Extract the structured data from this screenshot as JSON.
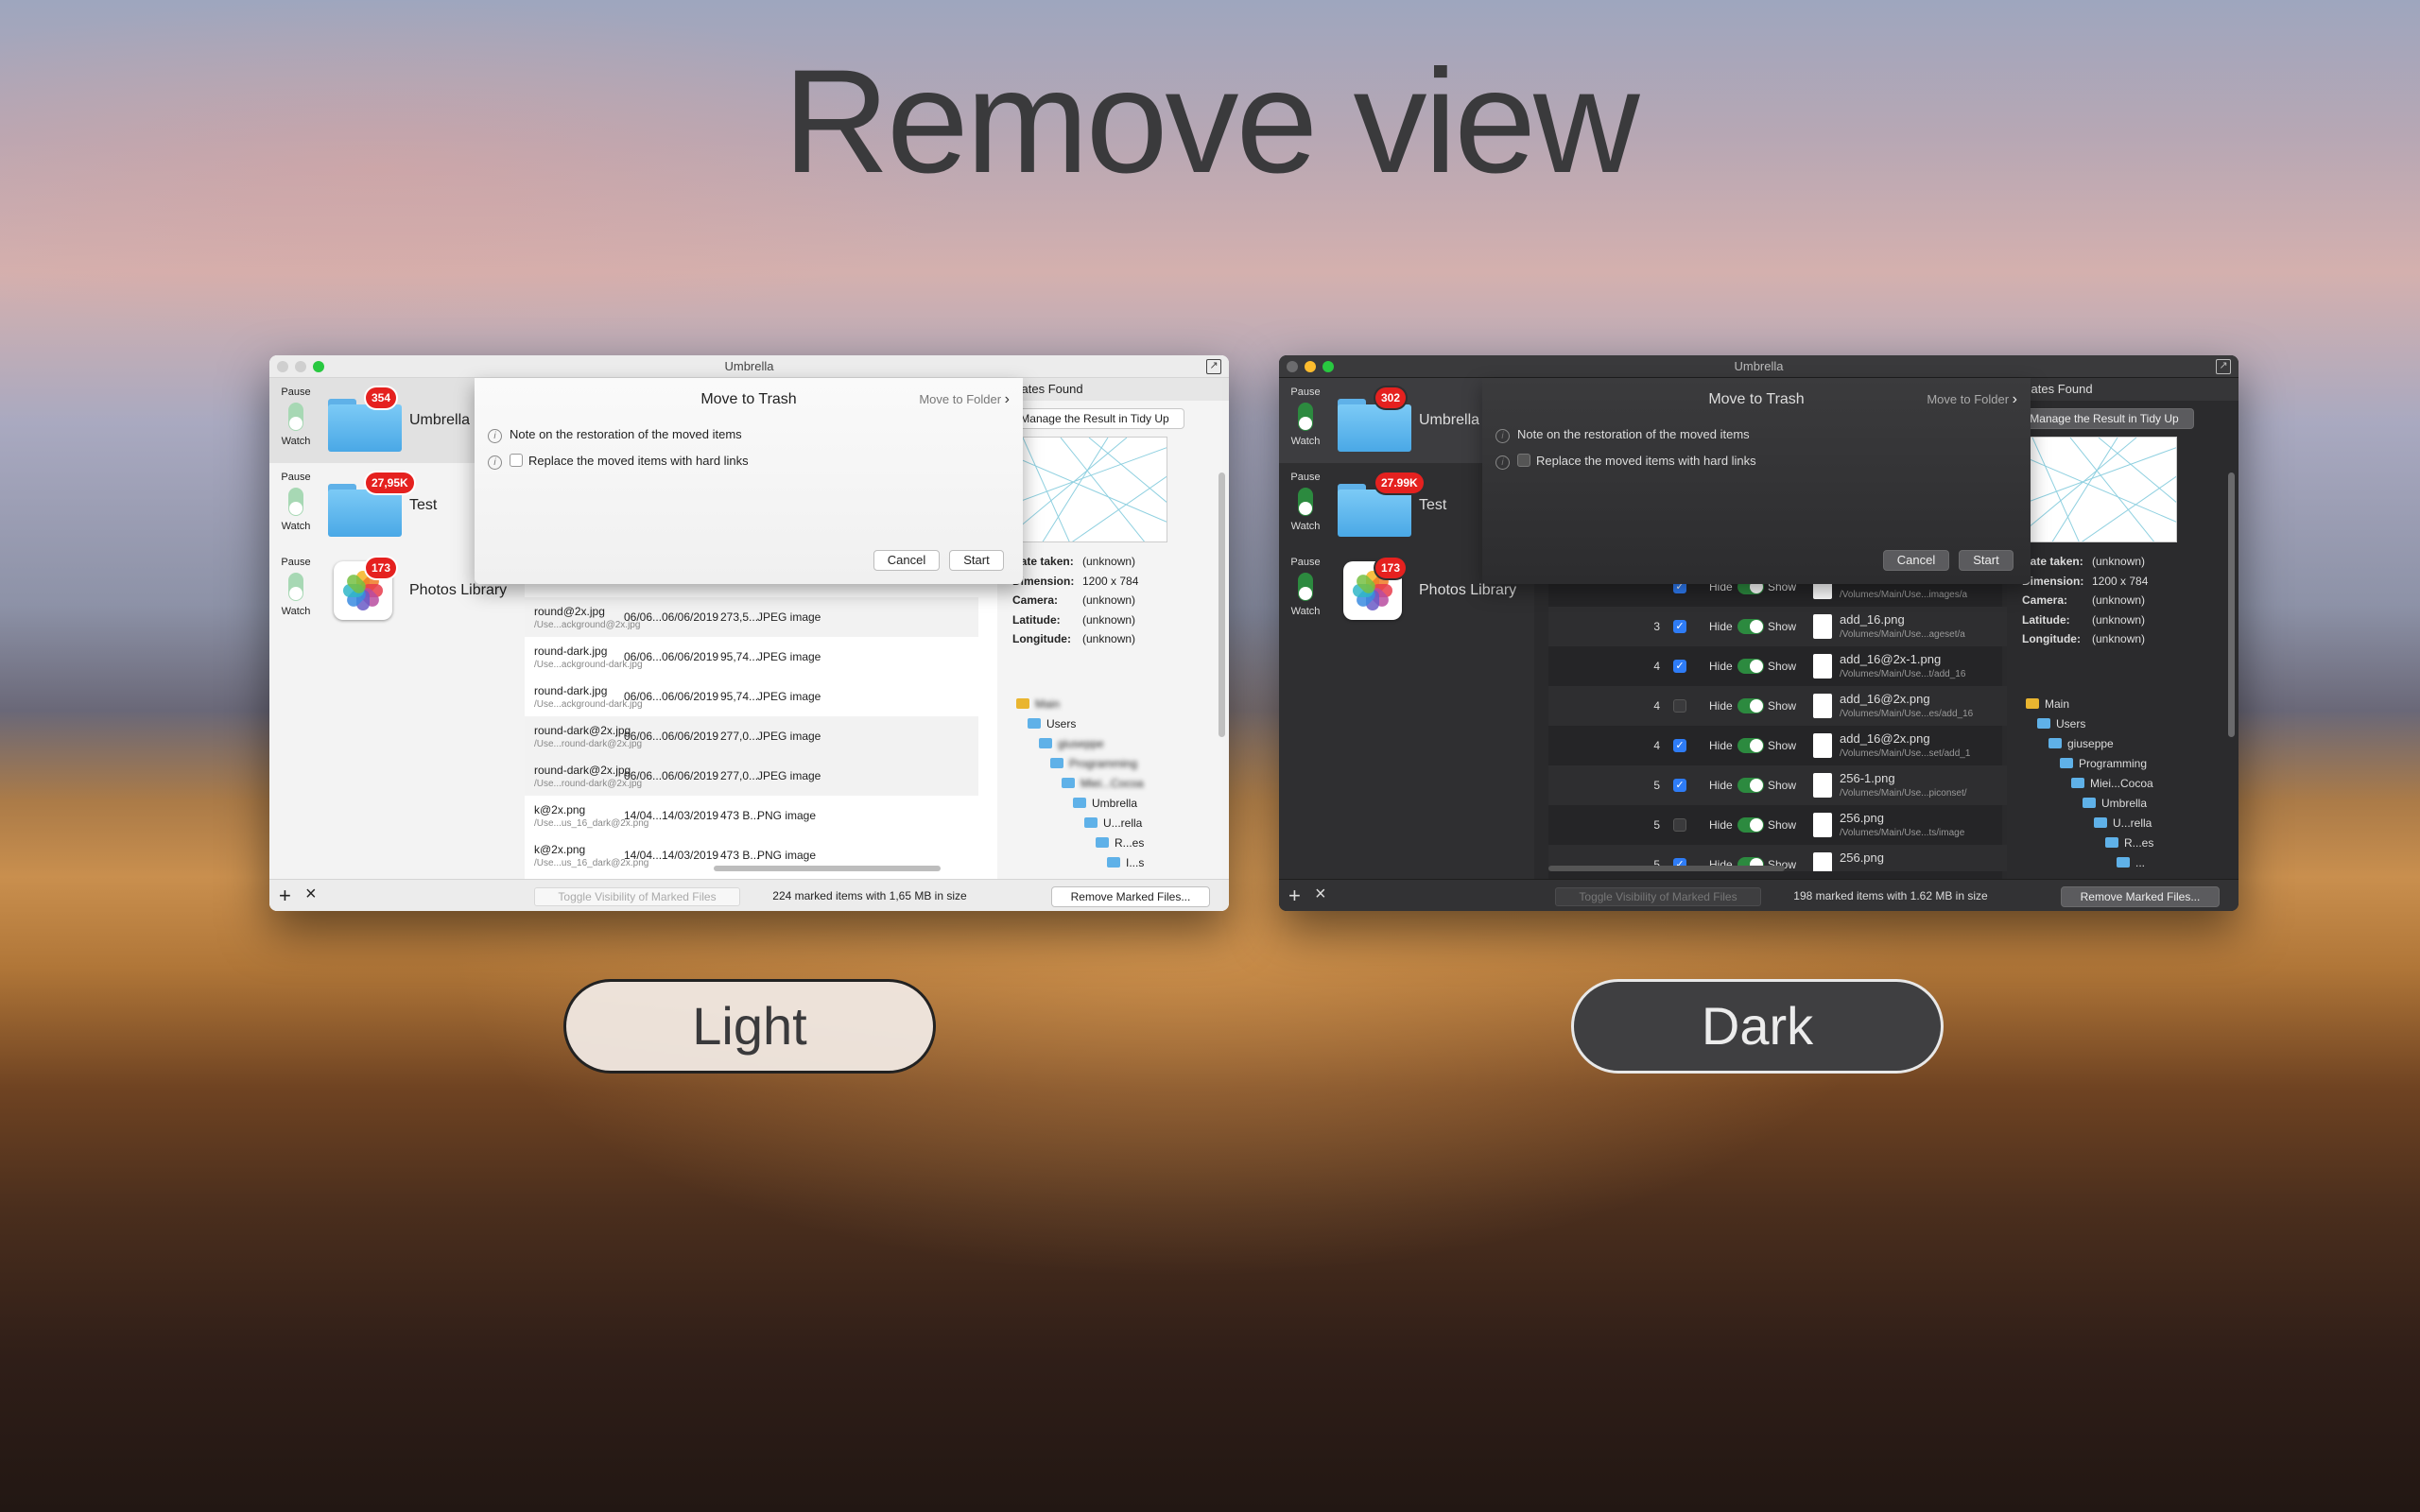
{
  "hero": {
    "title": "Remove view"
  },
  "light": {
    "window_title": "Umbrella",
    "sidebar": [
      {
        "pause": "Pause",
        "watch": "Watch",
        "badge": "354",
        "name": "Umbrella",
        "icon": "folder"
      },
      {
        "pause": "Pause",
        "watch": "Watch",
        "badge": "27,95K",
        "name": "Test",
        "icon": "folder"
      },
      {
        "pause": "Pause",
        "watch": "Watch",
        "badge": "173",
        "name": "Photos Library",
        "icon": "photos"
      }
    ],
    "rows": [
      {
        "name": "round@2x.jpg",
        "path": "/Use...ackground@2x.jpg",
        "c1": "06/06...",
        "c2": "06/06/2019",
        "c3": "273,5...",
        "c4": "JPEG image"
      },
      {
        "name": "round-dark.jpg",
        "path": "/Use...ackground-dark.jpg",
        "c1": "06/06...",
        "c2": "06/06/2019",
        "c3": "95,74...",
        "c4": "JPEG image"
      },
      {
        "name": "round-dark.jpg",
        "path": "/Use...ackground-dark.jpg",
        "c1": "06/06...",
        "c2": "06/06/2019",
        "c3": "95,74...",
        "c4": "JPEG image"
      },
      {
        "name": "round-dark@2x.jpg",
        "path": "/Use...round-dark@2x.jpg",
        "c1": "06/06...",
        "c2": "06/06/2019",
        "c3": "277,0...",
        "c4": "JPEG image"
      },
      {
        "name": "round-dark@2x.jpg",
        "path": "/Use...round-dark@2x.jpg",
        "c1": "06/06...",
        "c2": "06/06/2019",
        "c3": "277,0...",
        "c4": "JPEG image"
      },
      {
        "name": "k@2x.png",
        "path": "/Use...us_16_dark@2x.png",
        "c1": "14/04...",
        "c2": "14/03/2019",
        "c3": "473 B...",
        "c4": "PNG image"
      },
      {
        "name": "k@2x.png",
        "path": "/Use...us_16_dark@2x.png",
        "c1": "14/04...",
        "c2": "14/03/2019",
        "c3": "473 B...",
        "c4": "PNG image"
      }
    ],
    "right": {
      "header": "plicates Found",
      "button": "Manage the Result in Tidy Up",
      "meta": [
        {
          "k": "Date taken:",
          "v": "(unknown)"
        },
        {
          "k": "Dimension:",
          "v": "1200 x 784"
        },
        {
          "k": "Camera:",
          "v": "(unknown)"
        },
        {
          "k": "Latitude:",
          "v": "(unknown)"
        },
        {
          "k": "Longitude:",
          "v": "(unknown)"
        }
      ],
      "tree": [
        "Main",
        "Users",
        "giuseppe",
        "Programming",
        "Miei...Cocoa",
        "Umbrella",
        "U...rella",
        "R...es",
        "I...s"
      ]
    },
    "sheet": {
      "title": "Move to Trash",
      "move_to_folder": "Move to Folder",
      "note": "Note on the restoration of the moved items",
      "replace": "Replace the moved items with hard links",
      "cancel": "Cancel",
      "start": "Start"
    },
    "footer": {
      "toggle": "Toggle Visibility of Marked Files",
      "status": "224 marked items with 1,65 MB in size",
      "remove": "Remove Marked Files..."
    }
  },
  "dark": {
    "window_title": "Umbrella",
    "sidebar": [
      {
        "pause": "Pause",
        "watch": "Watch",
        "badge": "302",
        "name": "Umbrella",
        "icon": "folder"
      },
      {
        "pause": "Pause",
        "watch": "Watch",
        "badge": "27.99K",
        "name": "Test",
        "icon": "folder"
      },
      {
        "pause": "Pause",
        "watch": "Watch",
        "badge": "173",
        "name": "Photos Library",
        "icon": "photos"
      }
    ],
    "rows": [
      {
        "num": "",
        "checked": true,
        "hide": "Hide",
        "show": "Show",
        "name": "",
        "path": "/Volumes/Main/Use...images/a"
      },
      {
        "num": "3",
        "checked": true,
        "hide": "Hide",
        "show": "Show",
        "name": "add_16.png",
        "path": "/Volumes/Main/Use...ageset/a"
      },
      {
        "num": "4",
        "checked": true,
        "hide": "Hide",
        "show": "Show",
        "name": "add_16@2x-1.png",
        "path": "/Volumes/Main/Use...t/add_16"
      },
      {
        "num": "4",
        "checked": false,
        "hide": "Hide",
        "show": "Show",
        "name": "add_16@2x.png",
        "path": "/Volumes/Main/Use...es/add_16"
      },
      {
        "num": "4",
        "checked": true,
        "hide": "Hide",
        "show": "Show",
        "name": "add_16@2x.png",
        "path": "/Volumes/Main/Use...set/add_1"
      },
      {
        "num": "5",
        "checked": true,
        "hide": "Hide",
        "show": "Show",
        "name": "256-1.png",
        "path": "/Volumes/Main/Use...piconset/"
      },
      {
        "num": "5",
        "checked": false,
        "hide": "Hide",
        "show": "Show",
        "name": "256.png",
        "path": "/Volumes/Main/Use...ts/image"
      },
      {
        "num": "5",
        "checked": true,
        "hide": "Hide",
        "show": "Show",
        "name": "256.png",
        "path": ""
      }
    ],
    "right": {
      "header": "plicates Found",
      "button": "Manage the Result in Tidy Up",
      "meta": [
        {
          "k": "Date taken:",
          "v": "(unknown)"
        },
        {
          "k": "Dimension:",
          "v": "1200 x 784"
        },
        {
          "k": "Camera:",
          "v": "(unknown)"
        },
        {
          "k": "Latitude:",
          "v": "(unknown)"
        },
        {
          "k": "Longitude:",
          "v": "(unknown)"
        }
      ],
      "tree": [
        "Main",
        "Users",
        "giuseppe",
        "Programming",
        "Miei...Cocoa",
        "Umbrella",
        "U...rella",
        "R...es",
        "..."
      ]
    },
    "sheet": {
      "title": "Move to Trash",
      "move_to_folder": "Move to Folder",
      "note": "Note on the restoration of the moved items",
      "replace": "Replace the moved items with hard links",
      "cancel": "Cancel",
      "start": "Start"
    },
    "footer": {
      "toggle": "Toggle Visibility of Marked Files",
      "status": "198 marked items with 1.62 MB in size",
      "remove": "Remove Marked Files..."
    }
  },
  "labels": {
    "light": "Light",
    "dark": "Dark"
  },
  "colors": {
    "badge": "#e5211f",
    "folder": "#5fb1e8",
    "toggle_on": "#2c8a3f",
    "checkbox_on": "#2e7cf6"
  }
}
